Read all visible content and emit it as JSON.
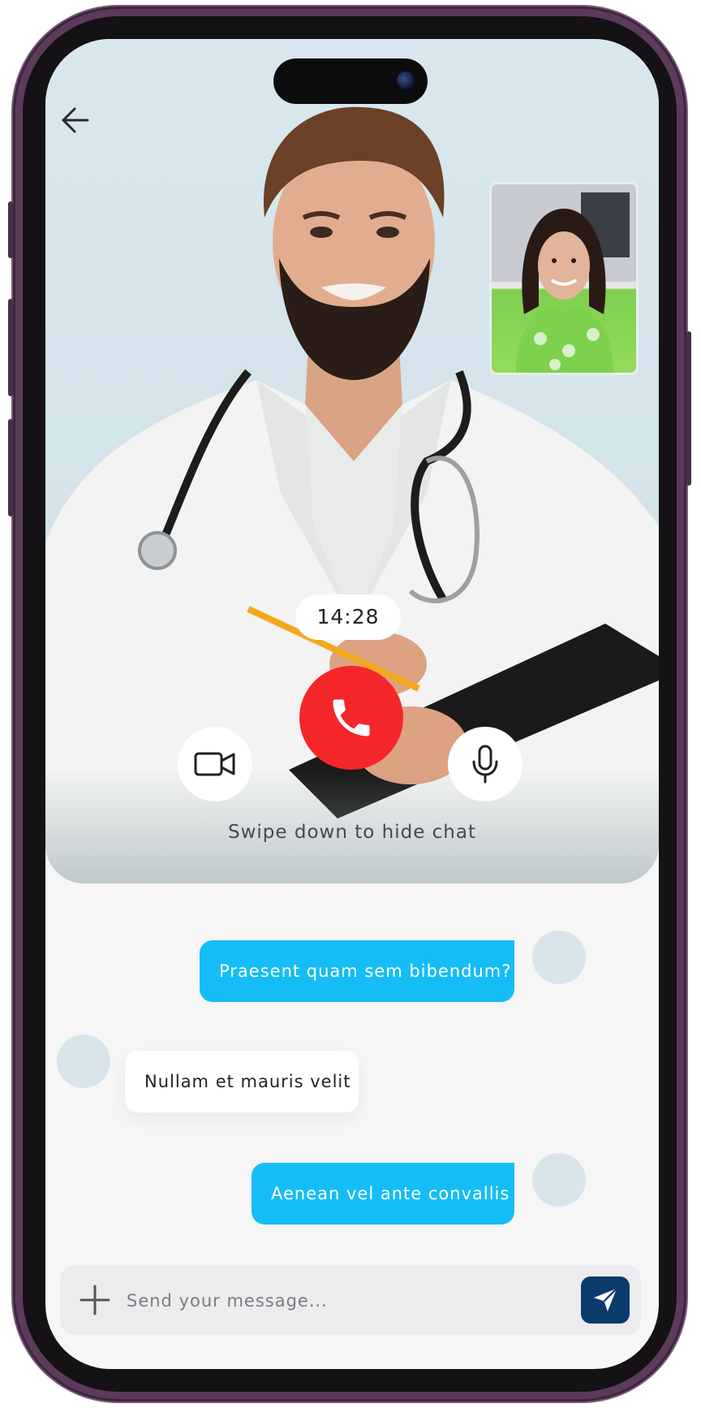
{
  "call": {
    "timer": "14:28",
    "hint": "Swipe down to hide chat"
  },
  "messages": [
    {
      "direction": "outgoing",
      "text": "Praesent quam sem bibendum?"
    },
    {
      "direction": "incoming",
      "text": "Nullam et mauris velit"
    },
    {
      "direction": "outgoing",
      "text": "Aenean vel ante convallis"
    }
  ],
  "composer": {
    "placeholder": "Send your message..."
  },
  "colors": {
    "end_call": "#f5262a",
    "outgoing_bubble": "#15bdf6",
    "send_button": "#0b3b6b",
    "phone_frame": "#5b3b5a"
  },
  "icons": {
    "back": "arrow-left-icon",
    "end_call": "phone-icon",
    "video": "video-camera-icon",
    "mic": "microphone-icon",
    "add": "plus-icon",
    "send": "paper-plane-icon"
  }
}
